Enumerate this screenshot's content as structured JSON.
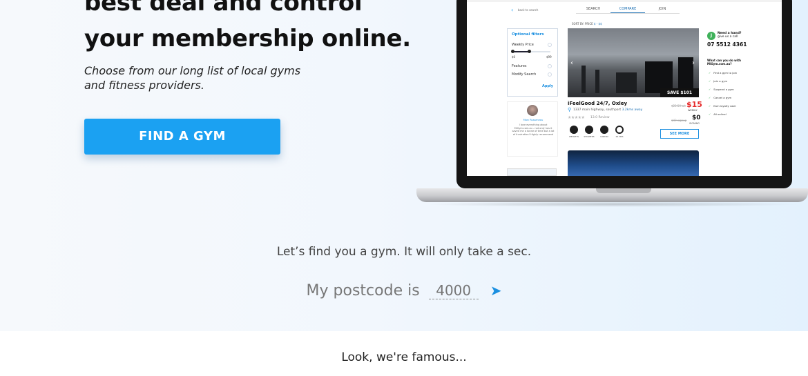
{
  "hero": {
    "title": "best deal and control your membership online.",
    "subtitle": "Choose from our long list of local gyms and fitness providers.",
    "cta_label": "FIND A GYM"
  },
  "screen": {
    "back_link": "back to search",
    "tabs": [
      "SEARCH",
      "COMPARE",
      "JOIN"
    ],
    "sort_label": "SORT BY: PRICE",
    "sort_value": "$ - $$",
    "filters": {
      "title": "Optional filters",
      "weekly_price": "Weekly Price",
      "min": "$0",
      "max": "$99",
      "features": "Features",
      "modify_search": "Modify Search",
      "apply": "Apply"
    },
    "review": {
      "name": "Marc Russeneau",
      "text": "I love everything about MiGym.com.au - not only has it saved me a tonne of time but a lot of frustration! Highly recommend"
    },
    "listing": {
      "save_badge": "SAVE $101",
      "name": "iFeelGood 24/7, Oxley",
      "address": "1337 main highway, southport",
      "distance": "3.2kms away",
      "review_count": "13.0 Review",
      "old_price": "$22.50 wk",
      "price": "$15",
      "price_unit": "WEEKLY",
      "old_signup": "$49 signup",
      "signup_price": "$0",
      "signup_label": "SIGNING",
      "features": [
        "WEIGHTS",
        "SHOWERS",
        "CARDIO",
        "24 HRS"
      ],
      "see_more": "SEE MORE"
    },
    "help": {
      "question": "Need a hand?",
      "call": "give us a call",
      "phone": "07 5512 4361",
      "can_title": "What can you do with",
      "can_site": "MiGym.com.au?",
      "items": [
        "Find a gym to join",
        "Join a gym",
        "Suspend a gym",
        "Cancel a gym",
        "Earn loyalty cash",
        "All online!"
      ]
    }
  },
  "search": {
    "prompt": "Let’s find you a gym. It will only take a sec.",
    "postcode_label": "My postcode is",
    "postcode_placeholder": "4000"
  },
  "footer": {
    "famous": "Look, we're famous..."
  },
  "colors": {
    "accent": "#1ba1f2",
    "price_red": "#e62c2c",
    "help_green": "#3fb15a"
  }
}
